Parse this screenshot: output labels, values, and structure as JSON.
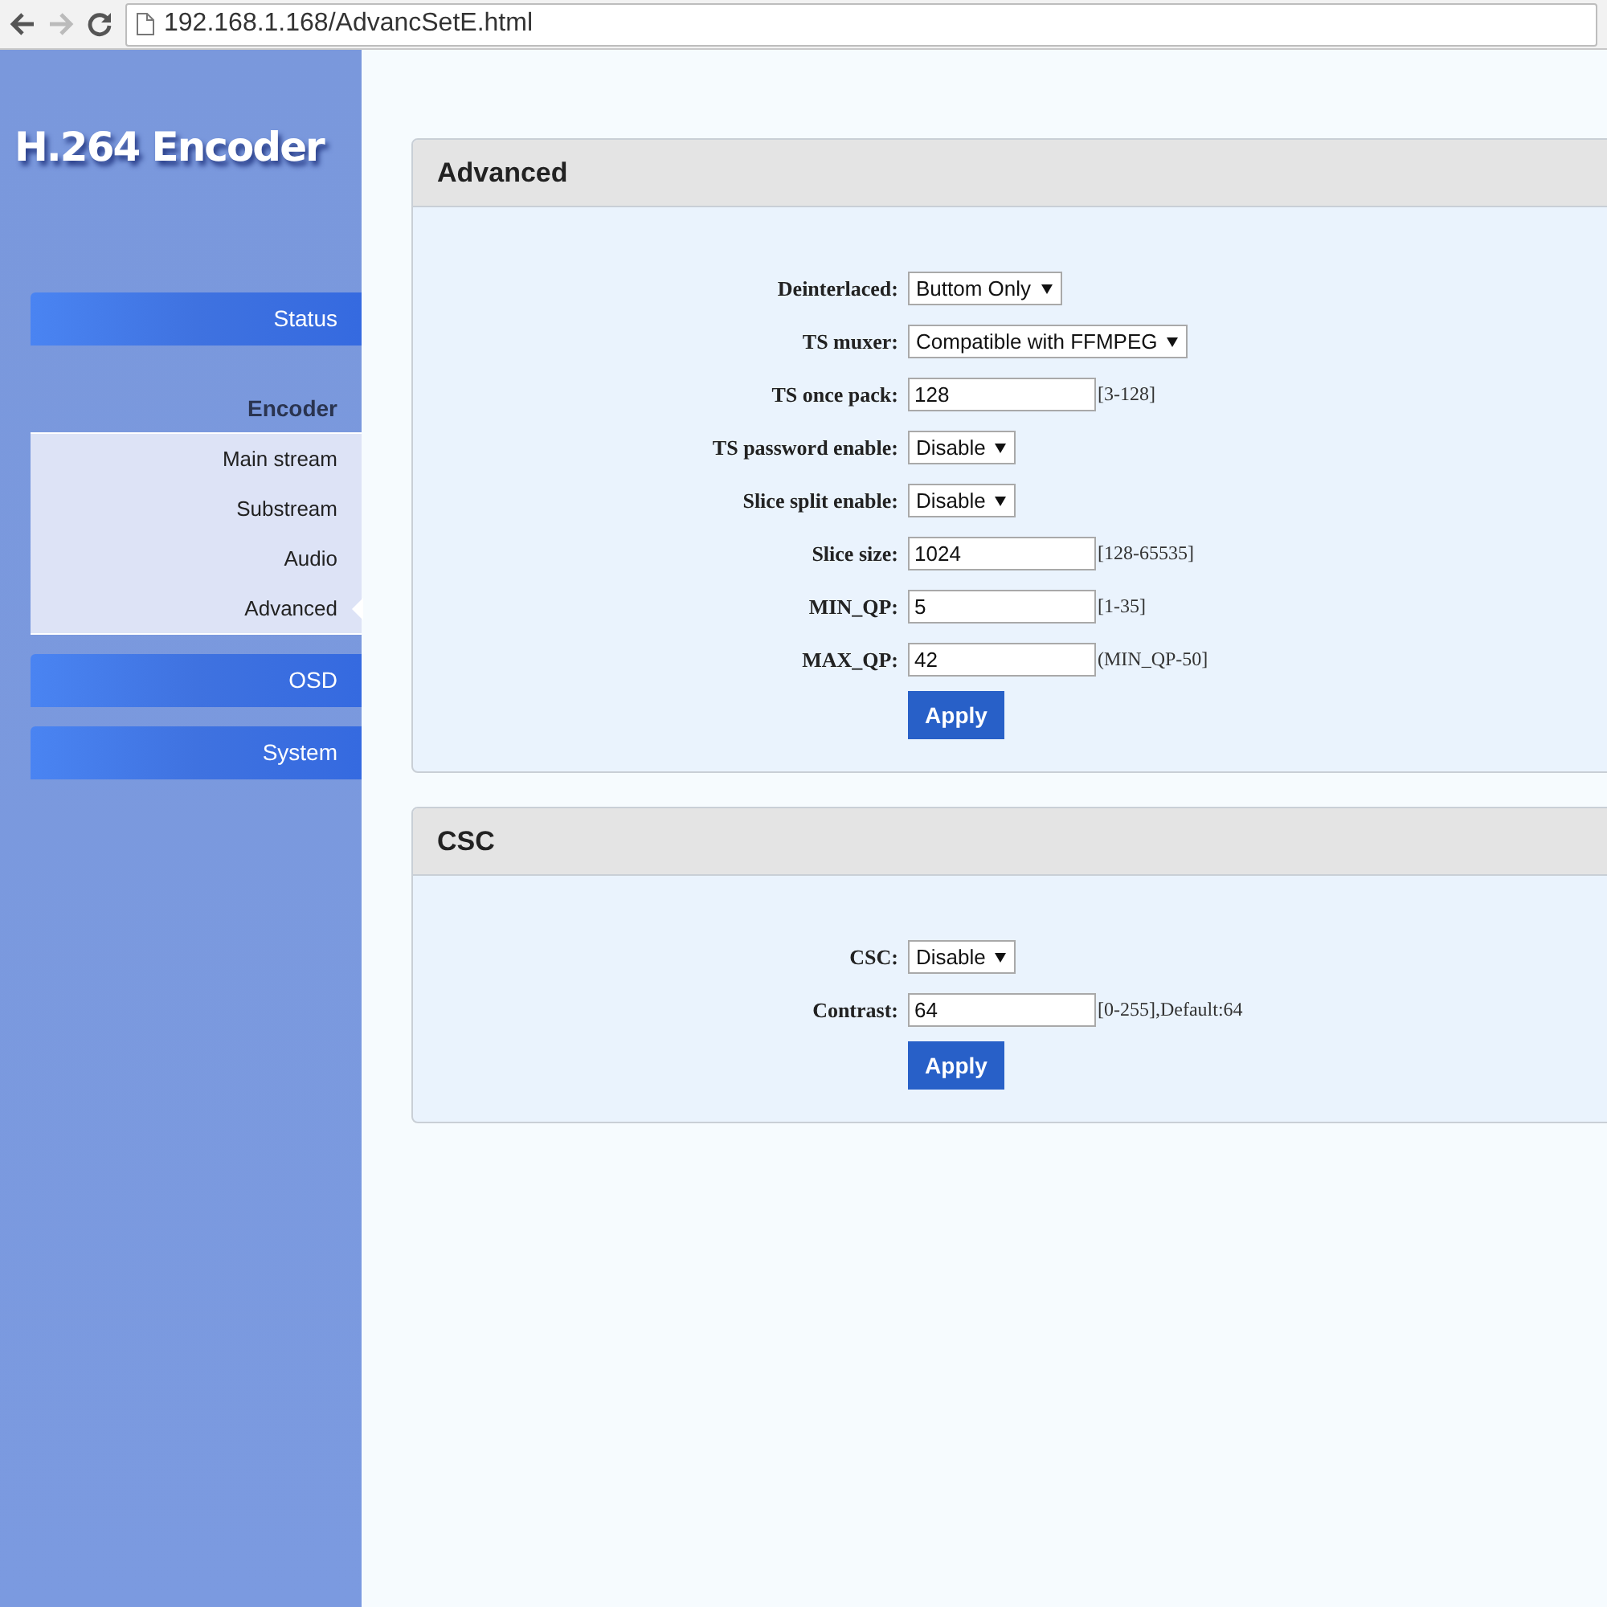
{
  "browser": {
    "url": "192.168.1.168/AdvancSetE.html"
  },
  "sidebar": {
    "logo": "H.264 Encoder",
    "items": [
      {
        "label": "Status",
        "kind": "button"
      },
      {
        "label": "Encoder",
        "kind": "section",
        "children": [
          {
            "label": "Main stream",
            "selected": false
          },
          {
            "label": "Substream",
            "selected": false
          },
          {
            "label": "Audio",
            "selected": false
          },
          {
            "label": "Advanced",
            "selected": true
          }
        ]
      },
      {
        "label": "OSD",
        "kind": "button"
      },
      {
        "label": "System",
        "kind": "button"
      }
    ]
  },
  "panels": [
    {
      "title": "Advanced",
      "fields": [
        {
          "label": "Deinterlaced:",
          "kind": "select",
          "value": "Buttom Only"
        },
        {
          "label": "TS muxer:",
          "kind": "select",
          "value": "Compatible with FFMPEG"
        },
        {
          "label": "TS once pack:",
          "kind": "input",
          "value": "128",
          "hint": "[3-128]"
        },
        {
          "label": "TS password enable:",
          "kind": "select",
          "value": "Disable"
        },
        {
          "label": "Slice split enable:",
          "kind": "select",
          "value": "Disable"
        },
        {
          "label": "Slice size:",
          "kind": "input",
          "value": "1024",
          "hint": "[128-65535]"
        },
        {
          "label": "MIN_QP:",
          "kind": "input",
          "value": "5",
          "hint": "[1-35]"
        },
        {
          "label": "MAX_QP:",
          "kind": "input",
          "value": "42",
          "hint": "(MIN_QP-50]"
        }
      ],
      "button": "Apply"
    },
    {
      "title": "CSC",
      "fields": [
        {
          "label": "CSC:",
          "kind": "select",
          "value": "Disable"
        },
        {
          "label": "Contrast:",
          "kind": "input",
          "value": "64",
          "hint": "[0-255],Default:64"
        }
      ],
      "button": "Apply"
    }
  ]
}
